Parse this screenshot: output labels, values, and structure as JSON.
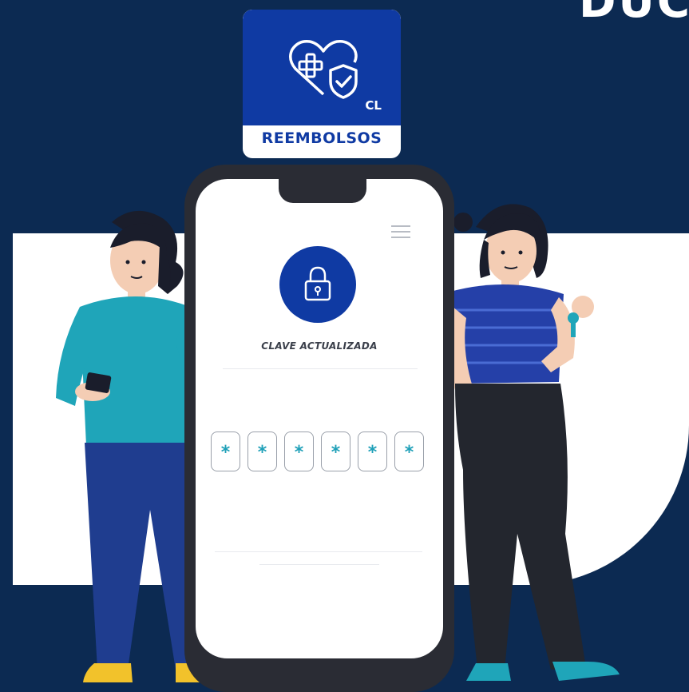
{
  "corner_text": "DUC",
  "app_card": {
    "logo": "heart-medical-shield-icon",
    "country": "CL",
    "name": "REEMBOLSOS"
  },
  "phone": {
    "menu": "hamburger-menu-icon",
    "lock": "padlock-icon",
    "status": "CLAVE ACTUALIZADA",
    "pin": [
      "*",
      "*",
      "*",
      "*",
      "*",
      "*"
    ]
  },
  "colors": {
    "background": "#0c2a52",
    "brand_blue": "#0f3aa3",
    "pin_accent": "#1fa0b8"
  }
}
